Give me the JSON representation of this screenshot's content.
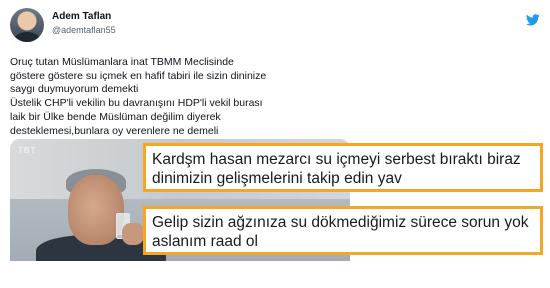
{
  "tweet": {
    "author_name": "Adem Taflan",
    "author_handle": "@ademtaflan55",
    "text": "Oruç tutan Müslümanlara inat TBMM Meclisinde\ngöstere göstere su içmek en hafif tabiri ile sizin dininize\nsaygı duymuyorum demekti\nÜstelik CHP'li vekilin bu davranışını HDP'li vekil burası\nlaik bir Ülke bende Müslüman değilim diyerek\ndesteklemesi,bunlara oy verenlere ne demeli",
    "media_label": "TBT"
  },
  "replies": [
    {
      "text": "Kardşm hasan mezarcı su içmeyi serbest bıraktı biraz dinimizin gelişmelerini takip edin yav"
    },
    {
      "text": "Gelip sizin ağzınıza su dökmediğimiz sürece sorun yok aslanım raad ol"
    }
  ],
  "colors": {
    "reply_border": "#f5a623",
    "twitter_blue": "#1d9bf0"
  },
  "icons": {
    "platform": "twitter-bird-icon"
  }
}
